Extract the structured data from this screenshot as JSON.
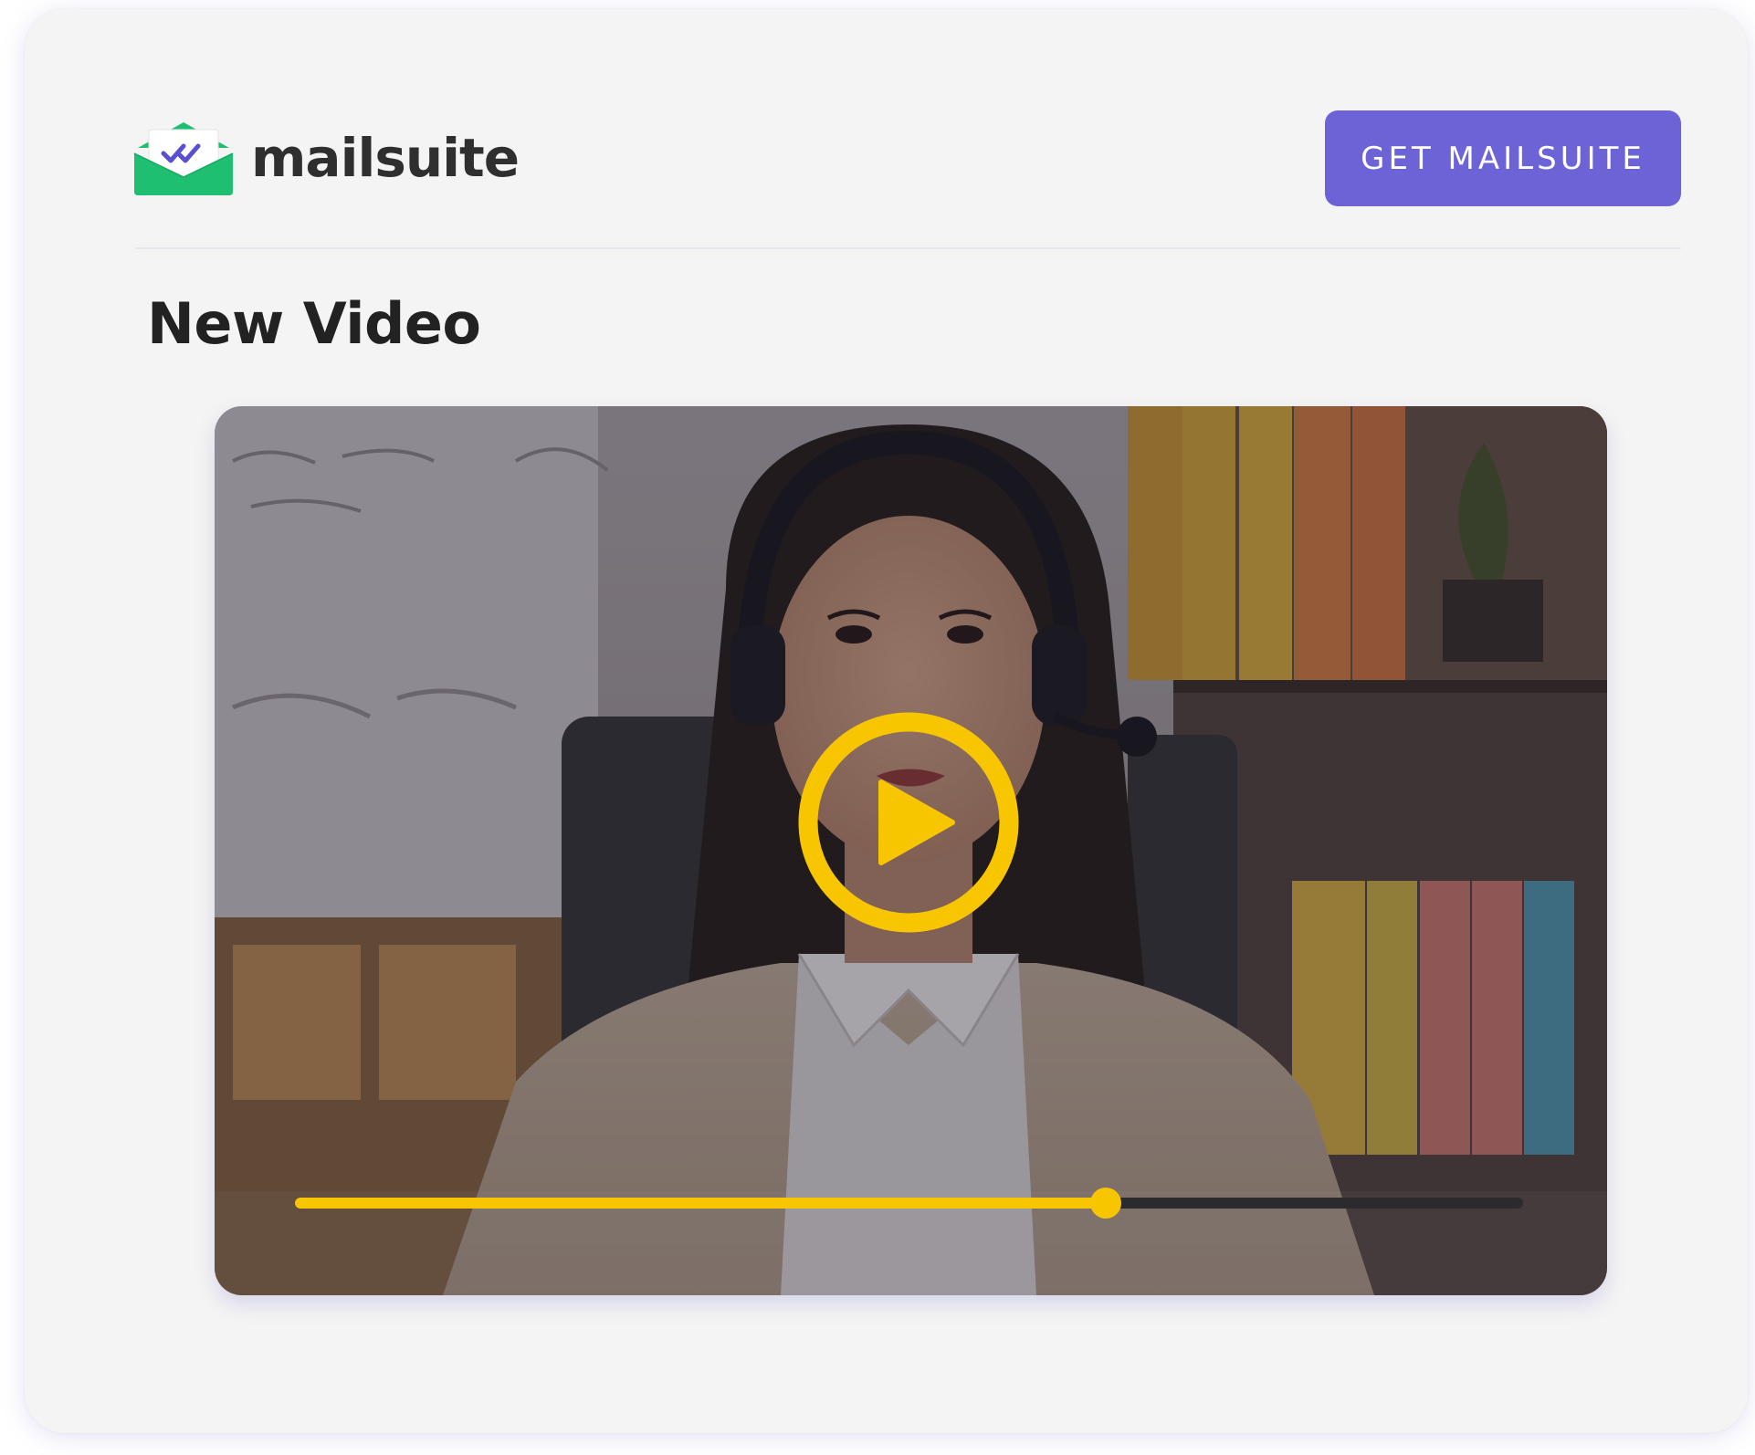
{
  "brand": {
    "name": "mailsuite",
    "icon": "envelope-check-icon",
    "icon_color": "#1fbf72",
    "check_color": "#5b4fd1"
  },
  "header": {
    "cta_label": "GET MAILSUITE",
    "cta_color": "#6c63d6"
  },
  "main": {
    "title": "New Video"
  },
  "video": {
    "play_icon": "play-circle-icon",
    "accent_color": "#f7c600",
    "progress": 0.66
  }
}
